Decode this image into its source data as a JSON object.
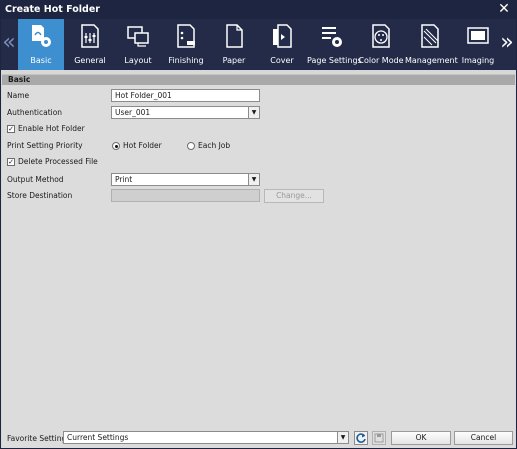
{
  "window": {
    "title": "Create Hot Folder"
  },
  "toolbar": {
    "tabs": [
      {
        "label": "Basic",
        "icon": "folder-gear-icon",
        "active": true
      },
      {
        "label": "General",
        "icon": "sliders-icon"
      },
      {
        "label": "Layout",
        "icon": "layout-icon"
      },
      {
        "label": "Finishing",
        "icon": "finishing-icon"
      },
      {
        "label": "Paper",
        "icon": "paper-icon"
      },
      {
        "label": "Cover",
        "icon": "cover-icon"
      },
      {
        "label": "Page Settings",
        "icon": "page-settings-icon"
      },
      {
        "label": "Color Mode",
        "icon": "palette-icon"
      },
      {
        "label": "Management",
        "icon": "management-icon"
      },
      {
        "label": "Imaging",
        "icon": "imaging-icon"
      }
    ]
  },
  "section": {
    "title": "Basic"
  },
  "form": {
    "name_label": "Name",
    "name_value": "Hot Folder_001",
    "auth_label": "Authentication",
    "auth_value": "User_001",
    "enable_label": "Enable Hot Folder",
    "enable_checked": true,
    "priority_label": "Print Setting Priority",
    "priority_opt1": "Hot Folder",
    "priority_opt2": "Each Job",
    "delete_label": "Delete Processed File",
    "delete_checked": true,
    "output_label": "Output Method",
    "output_value": "Print",
    "store_label": "Store Destination",
    "store_value": "",
    "change_button": "Change..."
  },
  "footer": {
    "favorite_label": "Favorite Setting",
    "favorite_value": "Current Settings",
    "ok_button": "OK",
    "cancel_button": "Cancel"
  },
  "colors": {
    "titlebar": "#1e2540",
    "toolbar": "#232b48",
    "active_tab": "#3d8fd0"
  }
}
